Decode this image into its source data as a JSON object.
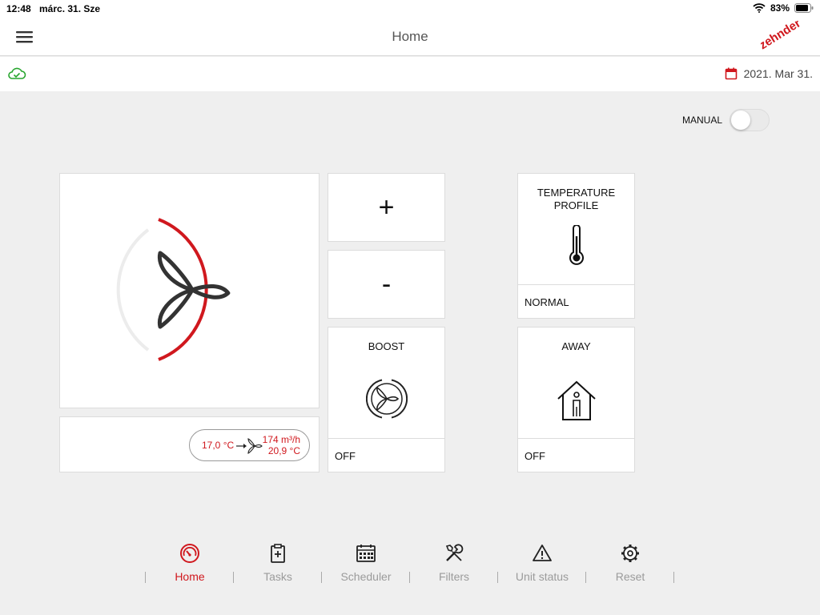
{
  "status_bar": {
    "time": "12:48",
    "date": "márc. 31. Sze",
    "battery": "83%"
  },
  "nav": {
    "title": "Home",
    "logo_text": "zehnder"
  },
  "info_bar": {
    "date": "2021. Mar 31."
  },
  "manual_toggle": {
    "label": "MANUAL",
    "on": false
  },
  "controls": {
    "plus_label": "+",
    "minus_label": "-"
  },
  "flow": {
    "temp_in": "17,0 °C",
    "airflow": "174 m³/h",
    "temp_out": "20,9 °C"
  },
  "boost": {
    "title": "BOOST",
    "status": "OFF"
  },
  "temperature_profile": {
    "title_line1": "TEMPERATURE",
    "title_line2": "PROFILE",
    "status": "NORMAL"
  },
  "away": {
    "title": "AWAY",
    "status": "OFF"
  },
  "tabs": [
    {
      "label": "Home",
      "icon": "gauge-icon",
      "active": true
    },
    {
      "label": "Tasks",
      "icon": "clipboard-icon",
      "active": false
    },
    {
      "label": "Scheduler",
      "icon": "calendar-icon",
      "active": false
    },
    {
      "label": "Filters",
      "icon": "tools-icon",
      "active": false
    },
    {
      "label": "Unit status",
      "icon": "warning-icon",
      "active": false
    },
    {
      "label": "Reset",
      "icon": "gear-icon",
      "active": false
    }
  ],
  "colors": {
    "accent": "#d0181e",
    "ok": "#27a52e",
    "background": "#efefef"
  }
}
